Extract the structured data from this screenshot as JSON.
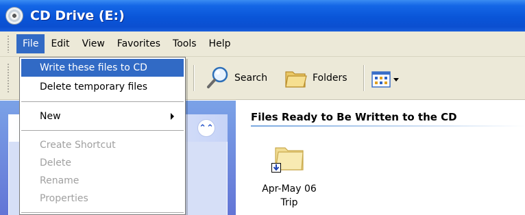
{
  "window": {
    "title": "CD Drive (E:)"
  },
  "menubar": {
    "items": [
      "File",
      "Edit",
      "View",
      "Favorites",
      "Tools",
      "Help"
    ],
    "active": "File"
  },
  "toolbar": {
    "search_label": "Search",
    "folders_label": "Folders"
  },
  "file_menu": {
    "items": [
      {
        "label": "Write these files to CD",
        "state": "highlighted"
      },
      {
        "label": "Delete temporary files",
        "state": "enabled"
      },
      {
        "label": "New",
        "state": "enabled",
        "submenu": true
      },
      {
        "label": "Create Shortcut",
        "state": "disabled"
      },
      {
        "label": "Delete",
        "state": "disabled"
      },
      {
        "label": "Rename",
        "state": "disabled"
      },
      {
        "label": "Properties",
        "state": "disabled"
      }
    ]
  },
  "content": {
    "section_title": "Files Ready to Be Written to the CD",
    "files": [
      {
        "name_line1": "Apr-May 06",
        "name_line2": "Trip",
        "icon": "folder-icon"
      }
    ]
  },
  "colors": {
    "titlebar": "#0b4fd0",
    "menu_highlight": "#316ac5",
    "taskpane": "#6375d6"
  }
}
